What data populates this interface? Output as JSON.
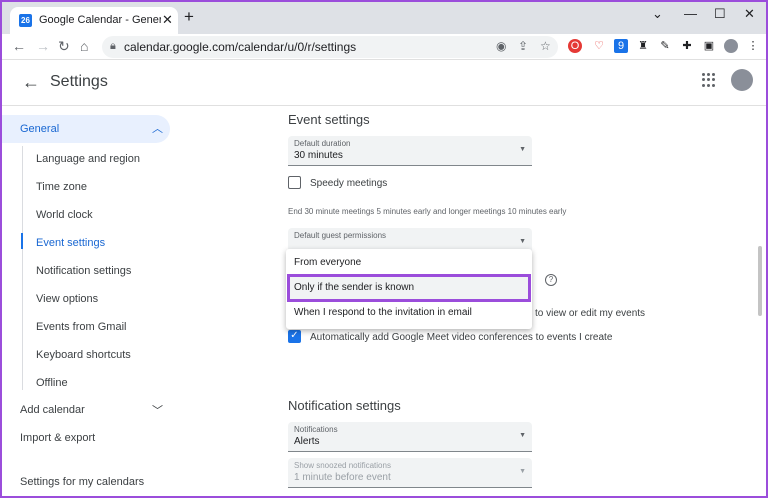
{
  "browser": {
    "tab_title": "Google Calendar - General settings",
    "favicon_text": "26",
    "url": "calendar.google.com/calendar/u/0/r/settings",
    "window_controls": [
      "⌄",
      "—",
      "☐",
      "✕"
    ]
  },
  "header": {
    "title": "Settings"
  },
  "sidebar": {
    "general": "General",
    "sub_items": [
      "Language and region",
      "Time zone",
      "World clock",
      "Event settings",
      "Notification settings",
      "View options",
      "Events from Gmail",
      "Keyboard shortcuts",
      "Offline"
    ],
    "active_index": 3,
    "add_calendar": "Add calendar",
    "import_export": "Import & export",
    "my_calendars": "Settings for my calendars"
  },
  "event_settings": {
    "title": "Event settings",
    "default_duration": {
      "label": "Default duration",
      "value": "30 minutes"
    },
    "speedy_meetings": "Speedy meetings",
    "speedy_helper": "End 30 minute meetings 5 minutes early and longer meetings 10 minutes early",
    "guest_permissions": {
      "label": "Default guest permissions"
    },
    "partial_text": "to view or edit my events",
    "auto_meet": "Automatically add Google Meet video conferences to events I create"
  },
  "dropdown": {
    "options": [
      "From everyone",
      "Only if the sender is known",
      "When I respond to the invitation in email"
    ],
    "highlighted_index": 1
  },
  "notification_settings": {
    "title": "Notification settings",
    "notifications": {
      "label": "Notifications",
      "value": "Alerts"
    },
    "snoozed": {
      "label": "Show snoozed notifications",
      "value": "1 minute before event"
    }
  }
}
